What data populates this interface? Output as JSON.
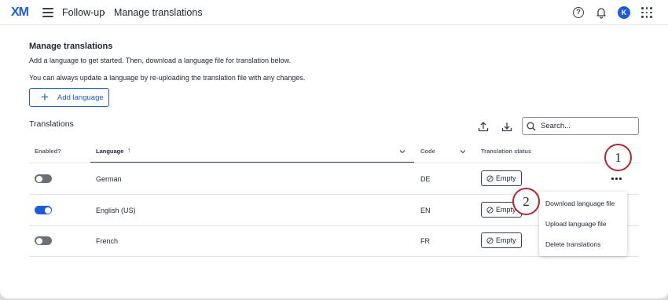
{
  "header": {
    "logo": "XM",
    "breadcrumb": [
      "Follow-up",
      "›",
      "Manage translations"
    ],
    "help_glyph": "?",
    "avatar_initial": "K",
    "icons": [
      "hamburger-menu-icon",
      "help-icon",
      "bell-icon",
      "apps-grid-icon"
    ]
  },
  "page": {
    "title": "Manage translations",
    "description1": "Add a language to get started. Then, download a language file for translation below.",
    "description2": "You can always update a language by re-uploading the translation file with any changes.",
    "add_language_label": "Add language",
    "add_language_glyph": "+"
  },
  "translations": {
    "title": "Translations",
    "search_placeholder": "Search...",
    "columns": {
      "enabled": "Enabled?",
      "language": "Language",
      "sort_arrow": "↑",
      "code": "Code",
      "status": "Translation status"
    },
    "rows": [
      {
        "enabled": false,
        "language": "German",
        "code": "DE",
        "status": "Empty"
      },
      {
        "enabled": true,
        "language": "English (US)",
        "code": "EN",
        "status": "Empty"
      },
      {
        "enabled": false,
        "language": "French",
        "code": "FR",
        "status": "Empty"
      }
    ]
  },
  "context_menu": {
    "items": [
      "Download language file",
      "Upload language file",
      "Delete translations"
    ]
  },
  "callouts": [
    "1",
    "2"
  ],
  "colors": {
    "accent": "#1e5bd8",
    "callout_border": "#b3262e",
    "toggle_off": "#6b6f78"
  }
}
